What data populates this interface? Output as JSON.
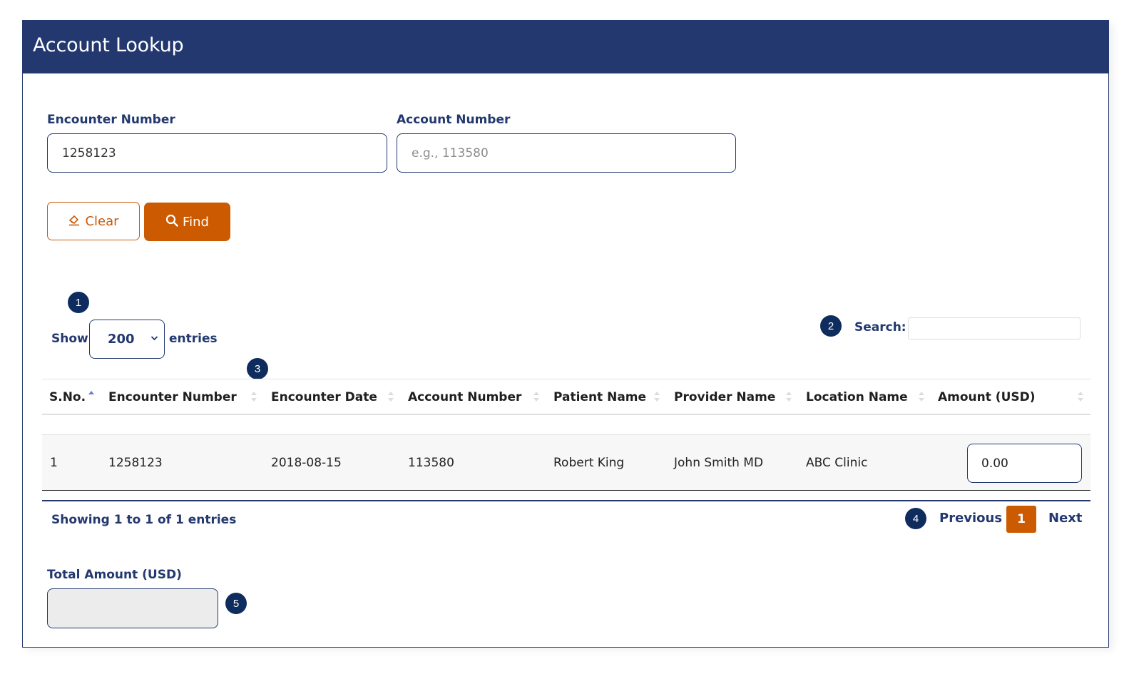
{
  "header": {
    "title": "Account Lookup"
  },
  "form": {
    "encounter_label": "Encounter Number",
    "encounter_value": "1258123",
    "account_label": "Account Number",
    "account_value": "",
    "account_placeholder": "e.g., 113580",
    "clear_label": "Clear",
    "find_label": "Find"
  },
  "badges": [
    "1",
    "2",
    "3",
    "4",
    "5"
  ],
  "length_menu": {
    "show_label": "Show",
    "selected": "200",
    "entries_label": "entries"
  },
  "search": {
    "label": "Search:",
    "value": ""
  },
  "table": {
    "columns": [
      "S.No.",
      "Encounter Number",
      "Encounter Date",
      "Account Number",
      "Patient Name",
      "Provider Name",
      "Location Name",
      "Amount (USD)"
    ],
    "sorted_column": "S.No.",
    "sort_direction": "ascending",
    "rows": [
      {
        "sno": "1",
        "encounter_number": "1258123",
        "encounter_date": "2018-08-15",
        "account_number": "113580",
        "patient_name": "Robert King",
        "provider_name": "John Smith MD",
        "location_name": "ABC Clinic",
        "amount": "0.00"
      }
    ]
  },
  "footer": {
    "info": "Showing 1 to 1 of 1 entries",
    "previous_label": "Previous",
    "current_page": "1",
    "next_label": "Next"
  },
  "total": {
    "label": "Total Amount (USD)",
    "value": ""
  },
  "colors": {
    "primary": "#22386f",
    "accent": "#cc5a00",
    "badge": "#0e2d5e"
  }
}
